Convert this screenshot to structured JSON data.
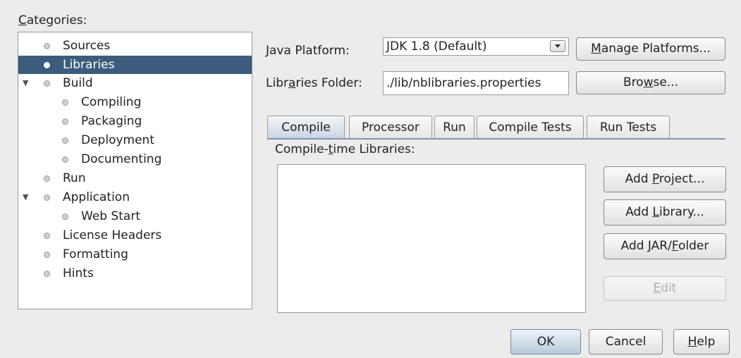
{
  "categories": {
    "label_mnemonic": "C",
    "label_rest": "ategories:",
    "items": [
      {
        "label": "Sources"
      },
      {
        "label": "Libraries"
      },
      {
        "label": "Build"
      },
      {
        "label": "Compiling"
      },
      {
        "label": "Packaging"
      },
      {
        "label": "Deployment"
      },
      {
        "label": "Documenting"
      },
      {
        "label": "Run"
      },
      {
        "label": "Application"
      },
      {
        "label": "Web Start"
      },
      {
        "label": "License Headers"
      },
      {
        "label": "Formatting"
      },
      {
        "label": "Hints"
      }
    ]
  },
  "java_platform": {
    "label_mnemonic": "J",
    "label_rest": "ava Platform:",
    "selected": "JDK 1.8 (Default)",
    "manage_button_mnemonic": "M",
    "manage_button_rest": "anage Platforms..."
  },
  "libraries_folder": {
    "label_pre": "Libr",
    "label_mnemonic": "a",
    "label_post": "ries Folder:",
    "value": "./lib/nblibraries.properties",
    "browse_pre": "Bro",
    "browse_mnemonic": "w",
    "browse_post": "se..."
  },
  "tabs": [
    {
      "label": "Compile"
    },
    {
      "label": "Processor"
    },
    {
      "label": "Run"
    },
    {
      "label": "Compile Tests"
    },
    {
      "label": "Run Tests"
    }
  ],
  "compile_libraries": {
    "label_pre": "Compile-",
    "label_mnemonic": "t",
    "label_post": "ime Libraries:"
  },
  "side_buttons": {
    "add_project_pre": "Add ",
    "add_project_mnemonic": "P",
    "add_project_post": "roject...",
    "add_library_pre": "Add ",
    "add_library_mnemonic": "L",
    "add_library_post": "ibrary...",
    "add_jar_pre": "Add JAR/",
    "add_jar_mnemonic": "F",
    "add_jar_post": "older",
    "edit_mnemonic": "E",
    "edit_post": "dit"
  },
  "dialog_buttons": {
    "ok": "OK",
    "cancel": "Cancel",
    "help_mnemonic": "H",
    "help_post": "elp"
  }
}
